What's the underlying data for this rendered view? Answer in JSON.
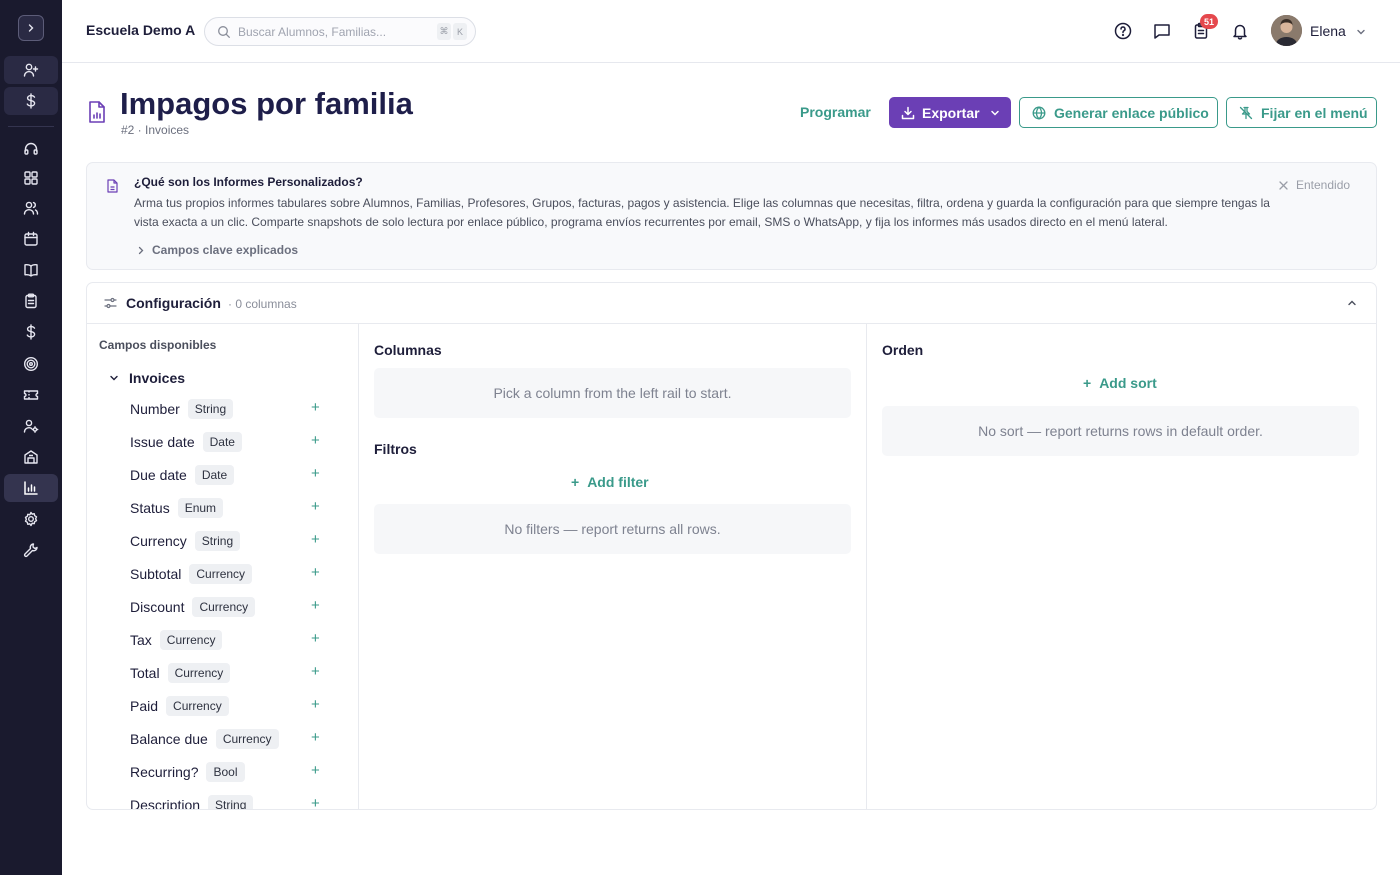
{
  "topbar": {
    "school_name": "Escuela Demo A",
    "search_placeholder": "Buscar Alumnos, Familias...",
    "kbd_meta": "⌘",
    "kbd_key": "K",
    "tasks_badge": "51",
    "user_name": "Elena"
  },
  "page": {
    "title": "Impagos por familia",
    "subtitle": "#2 · Invoices",
    "schedule_label": "Programar",
    "export_label": "Exportar",
    "public_link_label": "Generar enlace público",
    "pin_label": "Fijar en el menú"
  },
  "info": {
    "title": "¿Qué son los Informes Personalizados?",
    "body": "Arma tus propios informes tabulares sobre Alumnos, Familias, Profesores, Grupos, facturas, pagos y asistencia. Elige las columnas que necesitas, filtra, ordena y guarda la configuración para que siempre tengas la vista exacta a un clic. Comparte snapshots de solo lectura por enlace público, programa envíos recurrentes por email, SMS o WhatsApp, y fija los informes más usados directo en el menú lateral.",
    "dismiss_label": "Entendido",
    "more_label": "Campos clave explicados"
  },
  "config": {
    "title": "Configuración",
    "count": "· 0 columnas",
    "available_label": "Campos disponibles",
    "group_label": "Invoices",
    "fields": [
      {
        "name": "Number",
        "type": "String"
      },
      {
        "name": "Issue date",
        "type": "Date"
      },
      {
        "name": "Due date",
        "type": "Date"
      },
      {
        "name": "Status",
        "type": "Enum"
      },
      {
        "name": "Currency",
        "type": "String"
      },
      {
        "name": "Subtotal",
        "type": "Currency"
      },
      {
        "name": "Discount",
        "type": "Currency"
      },
      {
        "name": "Tax",
        "type": "Currency"
      },
      {
        "name": "Total",
        "type": "Currency"
      },
      {
        "name": "Paid",
        "type": "Currency"
      },
      {
        "name": "Balance due",
        "type": "Currency"
      },
      {
        "name": "Recurring?",
        "type": "Bool"
      },
      {
        "name": "Description",
        "type": "String"
      }
    ],
    "columns_title": "Columnas",
    "columns_empty": "Pick a column from the left rail to start.",
    "filters_title": "Filtros",
    "add_filter_label": "Add filter",
    "filters_empty": "No filters — report returns all rows.",
    "order_title": "Orden",
    "add_sort_label": "Add sort",
    "order_empty": "No sort — report returns rows in default order."
  },
  "colors": {
    "sidebar_bg": "#1a1a2e",
    "primary": "#6b3fb5",
    "teal": "#3a9a8a",
    "badge": "#e5484d"
  }
}
